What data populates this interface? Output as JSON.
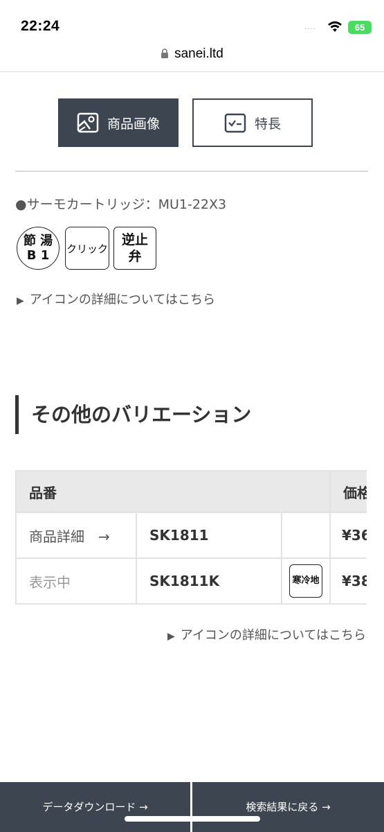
{
  "status_bar": {
    "time": "22:24",
    "signal": "....",
    "battery": "65"
  },
  "browser": {
    "url": "sanei.ltd"
  },
  "view_toggle": {
    "images_label": "商品画像",
    "features_label": "特長"
  },
  "product": {
    "cartridge": "●サーモカートリッジ：MU1-22X3",
    "icons": {
      "b1_top": "節 湯",
      "b1_bottom": "B 1",
      "click": "クリック",
      "check_top": "逆止",
      "check_bottom": "弁"
    },
    "icon_link": "アイコンの詳細についてはこちら"
  },
  "variations": {
    "title": "その他のバリエーション",
    "headers": [
      "品番",
      "",
      "",
      "価格"
    ],
    "rows": [
      {
        "status": "商品詳細　→",
        "code": "SK1811",
        "icon": "",
        "price": "¥36"
      },
      {
        "status": "表示中",
        "code": "SK1811K",
        "icon": "寒冷地",
        "price": "¥38"
      }
    ],
    "icon_link": "アイコンの詳細についてはこちら"
  },
  "bottom_bar": {
    "download": "データダウンロード →",
    "back": "検索結果に戻る →"
  },
  "colors": {
    "dark": "#3d4650",
    "battery": "#4cd964",
    "header_bg": "#e9e9e9"
  }
}
